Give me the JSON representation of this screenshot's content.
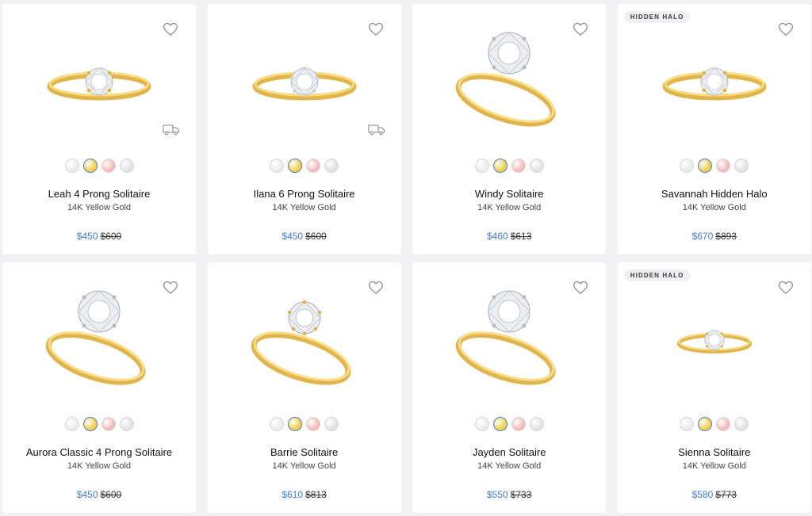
{
  "colors": {
    "accent": "#3f7ad6",
    "white_gold": "#e9e9ea",
    "yellow_gold": "#f3cf4a",
    "rose_gold": "#f3b9b9",
    "platinum": "#dcdcde"
  },
  "products": [
    {
      "name": "Leah 4 Prong Solitaire",
      "metal": "14K Yellow Gold",
      "price": "$450",
      "original_price": "$600",
      "badge": "",
      "favorite_icon": "heart-icon",
      "shipping_icon": "truck-icon",
      "setting": "4 prong"
    },
    {
      "name": "Ilana 6 Prong Solitaire",
      "metal": "14K Yellow Gold",
      "price": "$450",
      "original_price": "$600",
      "badge": "",
      "favorite_icon": "heart-icon",
      "shipping_icon": "truck-icon",
      "setting": "6 prong"
    },
    {
      "name": "Windy Solitaire",
      "metal": "14K Yellow Gold",
      "price": "$460",
      "original_price": "$613",
      "badge": "",
      "favorite_icon": "heart-icon",
      "setting": "4 prong"
    },
    {
      "name": "Savannah Hidden Halo",
      "metal": "14K Yellow Gold",
      "price": "$670",
      "original_price": "$893",
      "badge": "HIDDEN HALO",
      "favorite_icon": "heart-icon",
      "setting": "4 prong"
    },
    {
      "name": "Aurora Classic 4 Prong Solitaire",
      "metal": "14K Yellow Gold",
      "price": "$450",
      "original_price": "$600",
      "badge": "",
      "favorite_icon": "heart-icon",
      "setting": "4 prong"
    },
    {
      "name": "Barrie Solitaire",
      "metal": "14K Yellow Gold",
      "price": "$610",
      "original_price": "$813",
      "badge": "",
      "favorite_icon": "heart-icon",
      "setting": "6 prong"
    },
    {
      "name": "Jayden Solitaire",
      "metal": "14K Yellow Gold",
      "price": "$550",
      "original_price": "$733",
      "badge": "",
      "favorite_icon": "heart-icon",
      "setting": "4 prong"
    },
    {
      "name": "Sienna Solitaire",
      "metal": "14K Yellow Gold",
      "price": "$580",
      "original_price": "$773",
      "badge": "HIDDEN HALO",
      "favorite_icon": "heart-icon",
      "setting": "4 prong"
    }
  ],
  "metal_swatches": [
    {
      "name": "white-gold",
      "color": "#ececee"
    },
    {
      "name": "yellow-gold",
      "color": "#f3cf4a",
      "selected": true
    },
    {
      "name": "rose-gold",
      "color": "#f4baba"
    },
    {
      "name": "platinum",
      "color": "#e2e2e4"
    }
  ]
}
